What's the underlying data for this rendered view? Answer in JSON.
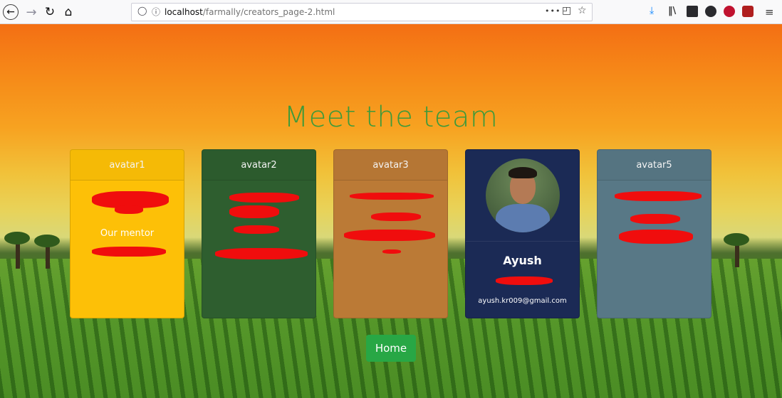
{
  "browser": {
    "url_host": "localhost",
    "url_path": "/farmally/creators_page-2.html",
    "more_label": "•••"
  },
  "page": {
    "title": "Meet the team",
    "home_label": "Home"
  },
  "cards": [
    {
      "header": "avatar1",
      "role": "Our mentor",
      "color": "#fdc007"
    },
    {
      "header": "avatar2",
      "color": "#2e5e2f"
    },
    {
      "header": "avatar3",
      "color": "#bb7a36"
    },
    {
      "name": "Ayush",
      "email": "ayush.kr009@gmail.com",
      "color": "#1b2a55"
    },
    {
      "header": "avatar5",
      "color": "#587886"
    }
  ],
  "icons": {
    "back": "back-arrow-icon",
    "forward": "forward-arrow-icon",
    "reload": "reload-icon",
    "home": "home-icon",
    "downloads": "download-icon",
    "library": "library-icon",
    "sidebar": "sidebar-icon",
    "account": "account-icon"
  }
}
